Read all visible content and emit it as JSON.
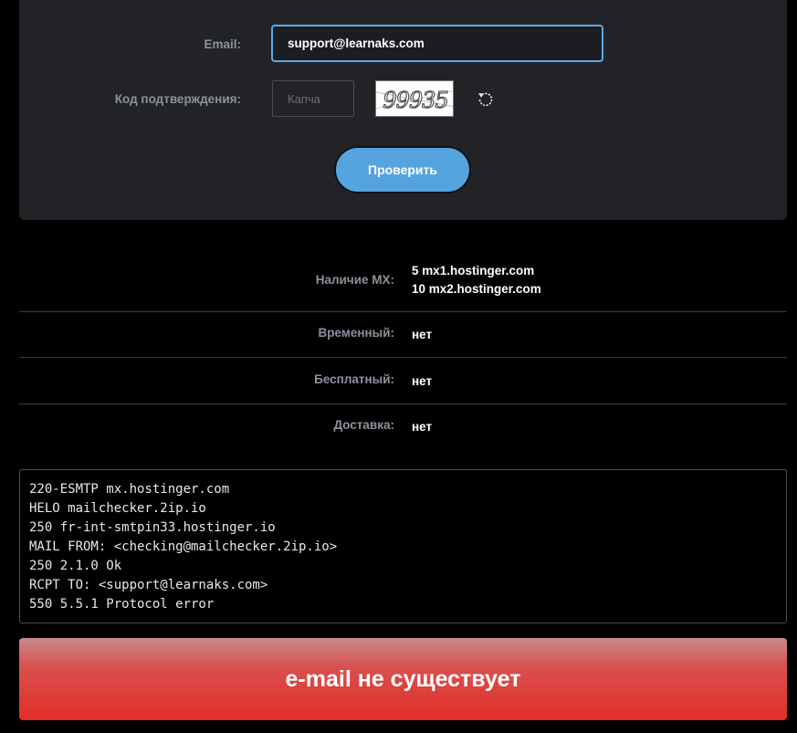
{
  "form": {
    "email_label": "Email:",
    "email_value": "support@learnaks.com",
    "captcha_label": "Код подтверждения:",
    "captcha_placeholder": "Капча",
    "captcha_text": "99935",
    "submit_label": "Проверить"
  },
  "results": {
    "mx": {
      "label": "Наличие MX:",
      "values": [
        "5 mx1.hostinger.com",
        "10 mx2.hostinger.com"
      ]
    },
    "temporary": {
      "label": "Временный:",
      "value": "нет"
    },
    "free": {
      "label": "Бесплатный:",
      "value": "нет"
    },
    "delivery": {
      "label": "Доставка:",
      "value": "нет"
    }
  },
  "log": [
    "220-ESMTP mx.hostinger.com",
    "HELO mailchecker.2ip.io",
    "250 fr-int-smtpin33.hostinger.io",
    "MAIL FROM: <checking@mailchecker.2ip.io>",
    "250 2.1.0 Ok",
    "RCPT TO: <support@learnaks.com>",
    "550 5.5.1 Protocol error"
  ],
  "result_text": "e-mail не существует",
  "icons": {
    "refresh": "refresh-icon"
  },
  "colors": {
    "accent": "#55a4e0",
    "error": "#e32d25",
    "panel": "#222326"
  }
}
